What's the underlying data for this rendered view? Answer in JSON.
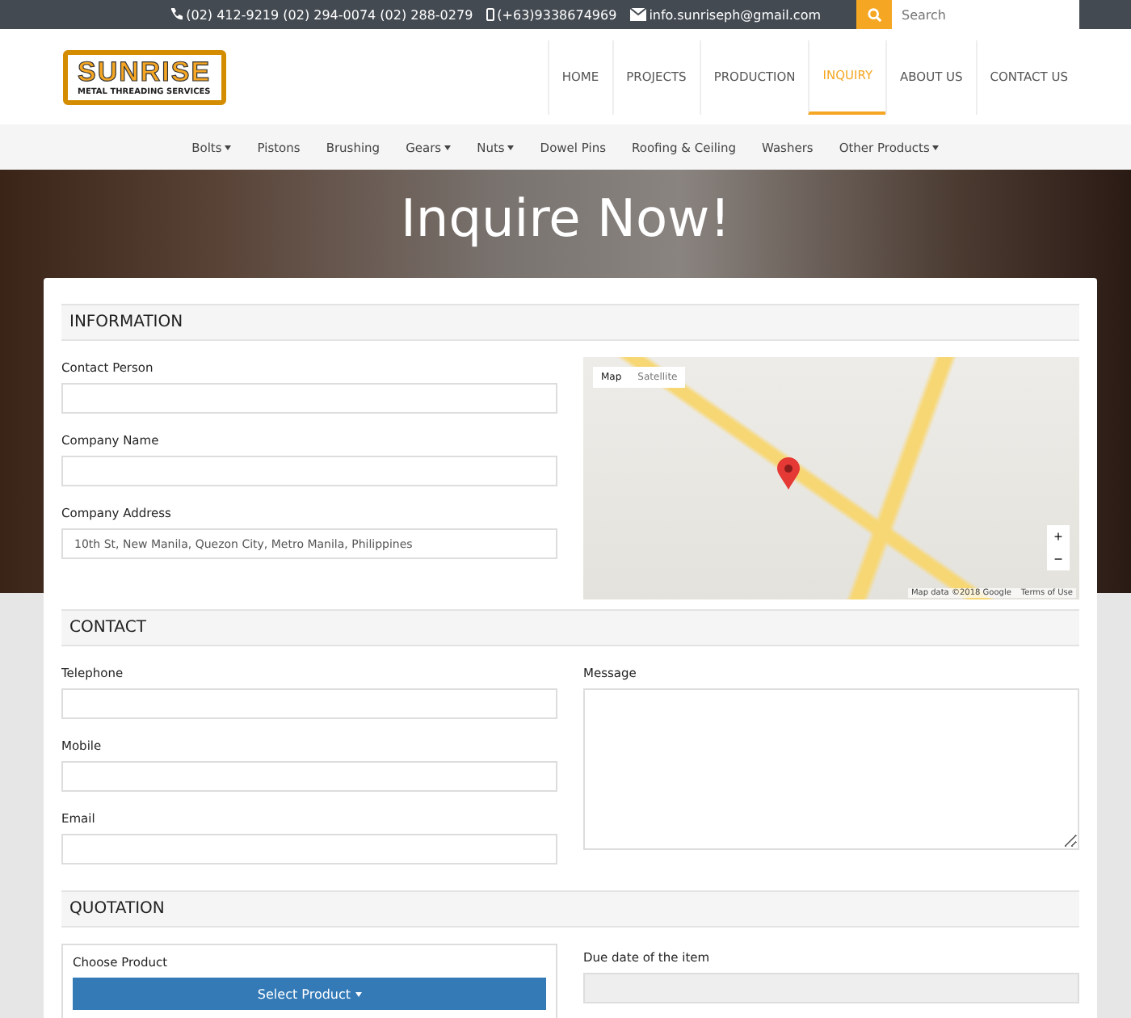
{
  "topbar": {
    "phones": "(02) 412-9219 (02) 294-0074 (02) 288-0279",
    "mobile": "(+63)9338674969",
    "email": "info.sunriseph@gmail.com",
    "search": {
      "placeholder": "Search"
    }
  },
  "logo": {
    "name": "SUNRISE",
    "tagline": "METAL THREADING SERVICES"
  },
  "nav": [
    {
      "label": "HOME",
      "selected": false
    },
    {
      "label": "PROJECTS",
      "selected": false
    },
    {
      "label": "PRODUCTION",
      "selected": false
    },
    {
      "label": "INQUIRY",
      "selected": true
    },
    {
      "label": "ABOUT US",
      "selected": false
    },
    {
      "label": "CONTACT US",
      "selected": false
    }
  ],
  "categories": [
    {
      "label": "Bolts",
      "dropdown": true
    },
    {
      "label": "Pistons",
      "dropdown": false
    },
    {
      "label": "Brushing",
      "dropdown": false
    },
    {
      "label": "Gears",
      "dropdown": true
    },
    {
      "label": "Nuts",
      "dropdown": true
    },
    {
      "label": "Dowel Pins",
      "dropdown": false
    },
    {
      "label": "Roofing & Ceiling",
      "dropdown": false
    },
    {
      "label": "Washers",
      "dropdown": false
    },
    {
      "label": "Other Products",
      "dropdown": true
    }
  ],
  "hero": {
    "title": "Inquire Now!"
  },
  "information": {
    "heading": "INFORMATION",
    "fields": [
      {
        "label": "Contact Person"
      },
      {
        "label": "Company Name"
      },
      {
        "label": "Company Address",
        "value": "10th St, New Manila, Quezon City, Metro Manila, Philippines"
      }
    ],
    "map": {
      "tabs": [
        {
          "label": "Map",
          "selected": true
        },
        {
          "label": "Satellite",
          "selected": false
        }
      ],
      "attribution": "Map data ©2018 Google",
      "terms": "Terms of Use",
      "zoom_in": "+",
      "zoom_out": "−"
    }
  },
  "contact": {
    "heading": "CONTACT",
    "fields": [
      {
        "label": "Telephone"
      },
      {
        "label": "Mobile"
      },
      {
        "label": "Email"
      }
    ],
    "message": {
      "label": "Message"
    }
  },
  "quotation": {
    "heading": "QUOTATION",
    "choose_label": "Choose Product",
    "select_button": "Select Product",
    "due_label": "Due date of the item"
  }
}
